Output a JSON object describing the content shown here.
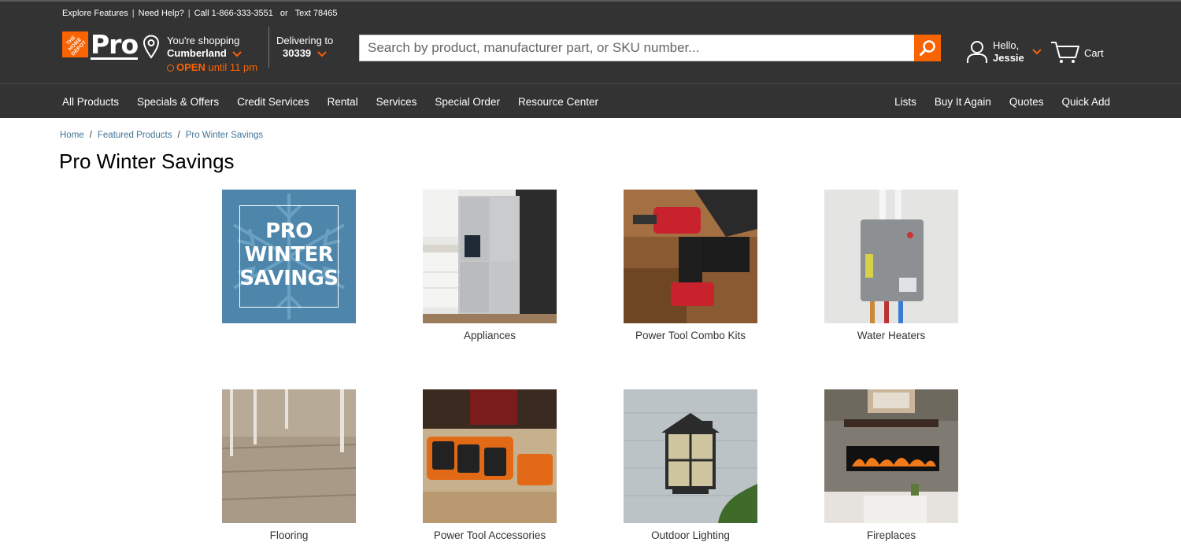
{
  "utility_bar": {
    "explore": "Explore Features",
    "help": "Need Help?",
    "call": "Call 1-866-333-3551",
    "or": "or",
    "text": "Text 78465",
    "sep": "|"
  },
  "header": {
    "logo_text": "Pro",
    "logo_badge": "THE HOME DEPOT",
    "store_prefix": "You're shopping",
    "store_name": "Cumberland",
    "open_label": "OPEN",
    "open_hours": "until 11 pm",
    "delivering_label": "Delivering to",
    "zip": "30339",
    "search_placeholder": "Search by product, manufacturer part, or SKU number...",
    "greeting": "Hello,",
    "user_name": "Jessie",
    "cart_label": "Cart"
  },
  "nav": {
    "left": [
      "All Products",
      "Specials & Offers",
      "Credit Services",
      "Rental",
      "Services",
      "Special Order",
      "Resource Center"
    ],
    "right": [
      "Lists",
      "Buy It Again",
      "Quotes",
      "Quick Add"
    ]
  },
  "breadcrumb": [
    "Home",
    "Featured Products",
    "Pro Winter Savings"
  ],
  "page_title": "Pro Winter Savings",
  "promo_tile": {
    "line1": "PRO",
    "line2": "WINTER",
    "line3": "SAVINGS"
  },
  "categories": [
    "Appliances",
    "Power Tool Combo Kits",
    "Water Heaters",
    "Flooring",
    "Power Tool Accessories",
    "Outdoor Lighting",
    "Fireplaces"
  ],
  "colors": {
    "brand": "#f96302",
    "header_bg": "#333333",
    "link": "#3e7697",
    "promo_bg": "#4d86aa"
  }
}
